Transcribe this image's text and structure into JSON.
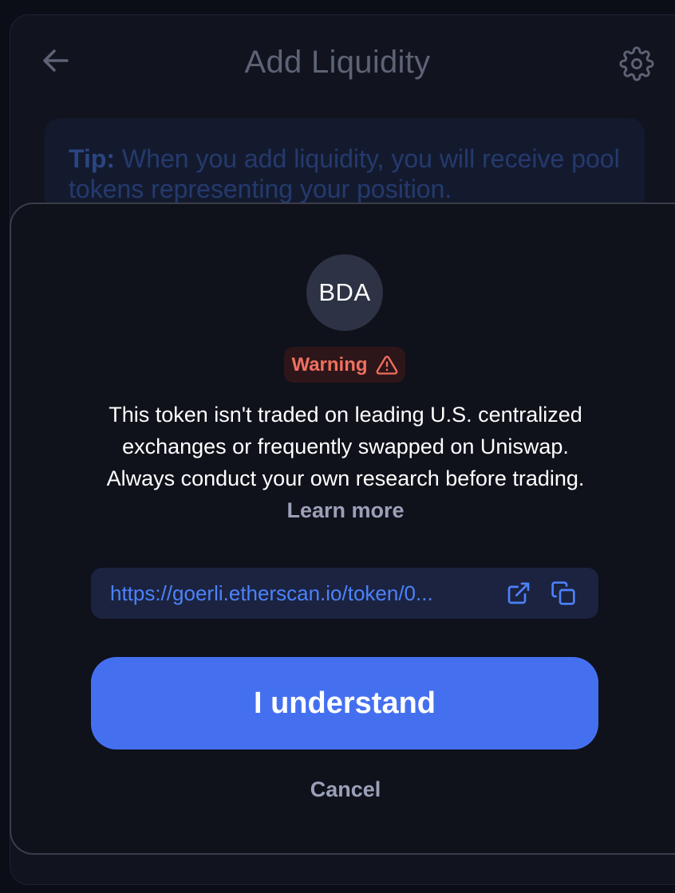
{
  "header": {
    "title": "Add Liquidity"
  },
  "tip": {
    "label": "Tip:",
    "text": "When you add liquidity, you will receive pool tokens representing your position."
  },
  "modal": {
    "token_symbol": "BDA",
    "warning_label": "Warning",
    "message": "This token isn't traded on leading U.S. centralized exchanges or frequently swapped on Uniswap. Always conduct your own research before trading.",
    "learn_more": "Learn more",
    "url": "https://goerli.etherscan.io/token/0...",
    "confirm_label": "I understand",
    "cancel_label": "Cancel"
  },
  "colors": {
    "accent": "#4470f0",
    "warning": "#f0705f",
    "link": "#4c82fb"
  },
  "icons": {
    "back": "arrow-left-icon",
    "settings": "gear-icon",
    "warning": "warning-triangle-icon",
    "external": "external-link-icon",
    "copy": "copy-icon"
  }
}
